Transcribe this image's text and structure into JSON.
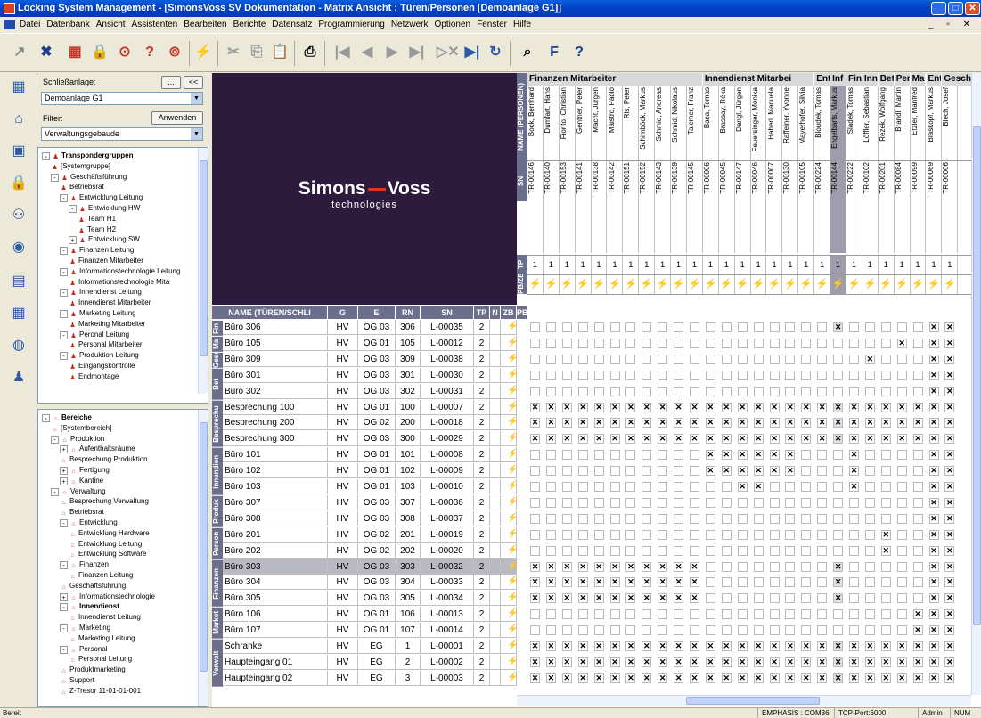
{
  "window": {
    "title": "Locking System Management - [SimonsVoss SV Dokumentation - Matrix Ansicht : Türen/Personen [Demoanlage G1]]"
  },
  "menu": [
    "Datei",
    "Datenbank",
    "Ansicht",
    "Assistenten",
    "Bearbeiten",
    "Berichte",
    "Datensatz",
    "Programmierung",
    "Netzwerk",
    "Optionen",
    "Fenster",
    "Hilfe"
  ],
  "filter": {
    "schliessanlage_label": "Schließanlage:",
    "schliessanlage_value": "Demoanlage G1",
    "browse_btn": "...",
    "collapse_btn": "<<",
    "filter_label": "Filter:",
    "apply_btn": "Anwenden",
    "filter_value": "Verwaltungsgebaude"
  },
  "tree_transponder": [
    {
      "d": 0,
      "t": "Transpondergruppen",
      "b": true,
      "exp": "-"
    },
    {
      "d": 1,
      "t": "[Systemgruppe]"
    },
    {
      "d": 1,
      "t": "Geschäftsführung",
      "exp": "-"
    },
    {
      "d": 2,
      "t": "Betriebsrat"
    },
    {
      "d": 2,
      "t": "Entwicklung Leitung",
      "exp": "-"
    },
    {
      "d": 3,
      "t": "Entwicklung HW",
      "exp": "-"
    },
    {
      "d": 4,
      "t": "Team H1"
    },
    {
      "d": 4,
      "t": "Team H2"
    },
    {
      "d": 3,
      "t": "Entwicklung SW",
      "exp": "+"
    },
    {
      "d": 2,
      "t": "Finanzen Leitung",
      "exp": "-"
    },
    {
      "d": 3,
      "t": "Finanzen Mitarbeiter"
    },
    {
      "d": 2,
      "t": "Informationstechnologie Leitung",
      "exp": "-"
    },
    {
      "d": 3,
      "t": "Informationstechnologie Mita"
    },
    {
      "d": 2,
      "t": "Innendienst Leitung",
      "exp": "-"
    },
    {
      "d": 3,
      "t": "Innendienst Mitarbeiter"
    },
    {
      "d": 2,
      "t": "Marketing Leitung",
      "exp": "-"
    },
    {
      "d": 3,
      "t": "Marketing Mitarbeiter"
    },
    {
      "d": 2,
      "t": "Peronal Leitung",
      "exp": "-"
    },
    {
      "d": 3,
      "t": "Personal Mitarbeiter"
    },
    {
      "d": 2,
      "t": "Produktion Leitung",
      "exp": "-"
    },
    {
      "d": 3,
      "t": "Eingangskontrolle"
    },
    {
      "d": 3,
      "t": "Endmontage"
    }
  ],
  "tree_bereiche": [
    {
      "d": 0,
      "t": "Bereiche",
      "b": true,
      "exp": "-"
    },
    {
      "d": 1,
      "t": "[Systembereich]"
    },
    {
      "d": 1,
      "t": "Produktion",
      "exp": "-"
    },
    {
      "d": 2,
      "t": "Aufenthaltsräume",
      "exp": "+"
    },
    {
      "d": 2,
      "t": "Besprechung Produktion"
    },
    {
      "d": 2,
      "t": "Fertigung",
      "exp": "+"
    },
    {
      "d": 2,
      "t": "Kantine",
      "exp": "+"
    },
    {
      "d": 1,
      "t": "Verwaltung",
      "exp": "-"
    },
    {
      "d": 2,
      "t": "Besprechung Verwaltung"
    },
    {
      "d": 2,
      "t": "Betriebsrat"
    },
    {
      "d": 2,
      "t": "Entwicklung",
      "exp": "-"
    },
    {
      "d": 3,
      "t": "Entwicklung Hardware"
    },
    {
      "d": 3,
      "t": "Entwicklung Leitung"
    },
    {
      "d": 3,
      "t": "Entwicklung Software"
    },
    {
      "d": 2,
      "t": "Finanzen",
      "exp": "-"
    },
    {
      "d": 3,
      "t": "Finanzen Leitung"
    },
    {
      "d": 2,
      "t": "Geschäftsführung"
    },
    {
      "d": 2,
      "t": "Informationstechnologie",
      "exp": "+"
    },
    {
      "d": 2,
      "t": "Innendienst",
      "b": true,
      "exp": "-"
    },
    {
      "d": 3,
      "t": "Innendienst Leitung"
    },
    {
      "d": 2,
      "t": "Marketing",
      "exp": "-"
    },
    {
      "d": 3,
      "t": "Marketing Leitung"
    },
    {
      "d": 2,
      "t": "Personal",
      "exp": "-"
    },
    {
      "d": 3,
      "t": "Personal Leitung"
    },
    {
      "d": 2,
      "t": "Produktmarketing"
    },
    {
      "d": 2,
      "t": "Support"
    },
    {
      "d": 2,
      "t": "Z-Tresor 11-01-01-001"
    }
  ],
  "logo": {
    "brand1": "Simons",
    "brand2": "Voss",
    "tagline": "technologies"
  },
  "matrix": {
    "side_labels": {
      "name": "NAME (PERSONEN)",
      "sn": "SN",
      "tp": "TP",
      "pbzb": "PB/ZB"
    },
    "person_groups": [
      {
        "label": "Finanzen Mitarbeiter",
        "span": 11
      },
      {
        "label": "Innendienst Mitarbei",
        "span": 7
      },
      {
        "label": "Ent",
        "span": 1
      },
      {
        "label": "Inf",
        "span": 1
      },
      {
        "label": "Fin",
        "span": 1
      },
      {
        "label": "Inn",
        "span": 1
      },
      {
        "label": "Bet",
        "span": 1
      },
      {
        "label": "Per",
        "span": 1
      },
      {
        "label": "Ma",
        "span": 1
      },
      {
        "label": "Ent",
        "span": 1
      },
      {
        "label": "Geschä",
        "span": 2
      }
    ],
    "persons": [
      {
        "name": "Bock, Bernhard",
        "sn": "TR-00146"
      },
      {
        "name": "Dumfart, Hans",
        "sn": "TR-00140"
      },
      {
        "name": "Fiorito, Christian",
        "sn": "TR-00153"
      },
      {
        "name": "Gentner, Peter",
        "sn": "TR-00141"
      },
      {
        "name": "Macht, Jürgen",
        "sn": "TR-00138"
      },
      {
        "name": "Maistro, Paolo",
        "sn": "TR-00142"
      },
      {
        "name": "Ris, Peter",
        "sn": "TR-00151"
      },
      {
        "name": "Schimböck, Markus",
        "sn": "TR-00152"
      },
      {
        "name": "Schmid, Andreas",
        "sn": "TR-00143"
      },
      {
        "name": "Schmid, Nikolaus",
        "sn": "TR-00139"
      },
      {
        "name": "Talemer, Franz",
        "sn": "TR-00145"
      },
      {
        "name": "Baca, Tomas",
        "sn": "TR-00006"
      },
      {
        "name": "Brassay, Réka",
        "sn": "TR-00045"
      },
      {
        "name": "Dangl, Jürgen",
        "sn": "TR-00147"
      },
      {
        "name": "Feuersinger, Monika",
        "sn": "TR-00046"
      },
      {
        "name": "Haberl, Manuela",
        "sn": "TR-00007"
      },
      {
        "name": "Raffeiner, Yvonne",
        "sn": "TR-00130"
      },
      {
        "name": "Mayerhofer, Silvia",
        "sn": "TR-00105"
      },
      {
        "name": "Bloudek, Tomas",
        "sn": "TR-00224"
      },
      {
        "name": "Engelbarts, Markus",
        "sn": "TR-00144",
        "sel": true
      },
      {
        "name": "Sladek, Tomas",
        "sn": "TR-00222"
      },
      {
        "name": "Löffler, Sebastian",
        "sn": "TR-00102"
      },
      {
        "name": "Rezek, Wolfgang",
        "sn": "TR-00201"
      },
      {
        "name": "Brandl, Martin",
        "sn": "TR-00084"
      },
      {
        "name": "Etzler, Manfred",
        "sn": "TR-00099"
      },
      {
        "name": "Blaskopf, Markus",
        "sn": "TR-00069"
      },
      {
        "name": "Blech, Josef",
        "sn": "TR-00006"
      }
    ],
    "tp_value": "1",
    "door_headers": [
      "NAME (TÜREN/SCHLI",
      "G",
      "E",
      "RN",
      "SN",
      "TP",
      "N",
      "ZB",
      "PB"
    ],
    "door_groups": [
      {
        "label": "Fin",
        "rows": 1
      },
      {
        "label": "Ma",
        "rows": 1
      },
      {
        "label": "Geschä",
        "rows": 1
      },
      {
        "label": "Bet",
        "rows": 2
      },
      {
        "label": "Besprechu",
        "rows": 3
      },
      {
        "label": "Innendien",
        "rows": 3
      },
      {
        "label": "Produk",
        "rows": 2
      },
      {
        "label": "Person",
        "rows": 2
      },
      {
        "label": "Finanzen",
        "rows": 3
      },
      {
        "label": "Market",
        "rows": 2
      },
      {
        "label": "Verwalt",
        "rows": 3
      }
    ],
    "doors": [
      {
        "name": "Büro 306",
        "g": "HV",
        "e": "OG 03",
        "rn": "306",
        "sn": "L-00035",
        "tp": "2",
        "x": [
          19,
          25,
          26
        ]
      },
      {
        "name": "Büro 105",
        "g": "HV",
        "e": "OG 01",
        "rn": "105",
        "sn": "L-00012",
        "tp": "2",
        "x": [
          23,
          25,
          26
        ]
      },
      {
        "name": "Büro 309",
        "g": "HV",
        "e": "OG 03",
        "rn": "309",
        "sn": "L-00038",
        "tp": "2",
        "x": [
          21,
          25,
          26
        ]
      },
      {
        "name": "Büro 301",
        "g": "HV",
        "e": "OG 03",
        "rn": "301",
        "sn": "L-00030",
        "tp": "2",
        "x": [
          25,
          26
        ]
      },
      {
        "name": "Büro 302",
        "g": "HV",
        "e": "OG 03",
        "rn": "302",
        "sn": "L-00031",
        "tp": "2",
        "x": [
          25,
          26
        ]
      },
      {
        "name": "Besprechung 100",
        "g": "HV",
        "e": "OG 01",
        "rn": "100",
        "sn": "L-00007",
        "tp": "2",
        "x": "all"
      },
      {
        "name": "Besprechung 200",
        "g": "HV",
        "e": "OG 02",
        "rn": "200",
        "sn": "L-00018",
        "tp": "2",
        "x": "all"
      },
      {
        "name": "Besprechung 300",
        "g": "HV",
        "e": "OG 03",
        "rn": "300",
        "sn": "L-00029",
        "tp": "2",
        "x": "all"
      },
      {
        "name": "Büro 101",
        "g": "HV",
        "e": "OG 01",
        "rn": "101",
        "sn": "L-00008",
        "tp": "2",
        "x": [
          11,
          12,
          13,
          14,
          15,
          16,
          20,
          25,
          26
        ]
      },
      {
        "name": "Büro 102",
        "g": "HV",
        "e": "OG 01",
        "rn": "102",
        "sn": "L-00009",
        "tp": "2",
        "x": [
          11,
          12,
          13,
          14,
          15,
          16,
          20,
          25,
          26
        ]
      },
      {
        "name": "Büro 103",
        "g": "HV",
        "e": "OG 01",
        "rn": "103",
        "sn": "L-00010",
        "tp": "2",
        "x": [
          13,
          14,
          20,
          25,
          26
        ]
      },
      {
        "name": "Büro 307",
        "g": "HV",
        "e": "OG 03",
        "rn": "307",
        "sn": "L-00036",
        "tp": "2",
        "x": [
          25,
          26
        ]
      },
      {
        "name": "Büro 308",
        "g": "HV",
        "e": "OG 03",
        "rn": "308",
        "sn": "L-00037",
        "tp": "2",
        "x": [
          25,
          26
        ]
      },
      {
        "name": "Büro 201",
        "g": "HV",
        "e": "OG 02",
        "rn": "201",
        "sn": "L-00019",
        "tp": "2",
        "x": [
          22,
          25,
          26
        ]
      },
      {
        "name": "Büro 202",
        "g": "HV",
        "e": "OG 02",
        "rn": "202",
        "sn": "L-00020",
        "tp": "2",
        "x": [
          22,
          25,
          26
        ]
      },
      {
        "name": "Büro 303",
        "g": "HV",
        "e": "OG 03",
        "rn": "303",
        "sn": "L-00032",
        "tp": "2",
        "x": [
          0,
          1,
          2,
          3,
          4,
          5,
          6,
          7,
          8,
          9,
          10,
          19,
          25,
          26
        ],
        "sel": true
      },
      {
        "name": "Büro 304",
        "g": "HV",
        "e": "OG 03",
        "rn": "304",
        "sn": "L-00033",
        "tp": "2",
        "x": [
          0,
          1,
          2,
          3,
          4,
          5,
          6,
          7,
          8,
          9,
          10,
          19,
          25,
          26
        ]
      },
      {
        "name": "Büro 305",
        "g": "HV",
        "e": "OG 03",
        "rn": "305",
        "sn": "L-00034",
        "tp": "2",
        "x": [
          0,
          1,
          2,
          3,
          4,
          5,
          6,
          7,
          8,
          9,
          10,
          19,
          25,
          26
        ]
      },
      {
        "name": "Büro 106",
        "g": "HV",
        "e": "OG 01",
        "rn": "106",
        "sn": "L-00013",
        "tp": "2",
        "x": [
          24,
          25,
          26
        ]
      },
      {
        "name": "Büro 107",
        "g": "HV",
        "e": "OG 01",
        "rn": "107",
        "sn": "L-00014",
        "tp": "2",
        "x": [
          24,
          25,
          26
        ]
      },
      {
        "name": "Schranke",
        "g": "HV",
        "e": "EG",
        "rn": "1",
        "sn": "L-00001",
        "tp": "2",
        "x": "all"
      },
      {
        "name": "Haupteingang 01",
        "g": "HV",
        "e": "EG",
        "rn": "2",
        "sn": "L-00002",
        "tp": "2",
        "x": "all"
      },
      {
        "name": "Haupteingang 02",
        "g": "HV",
        "e": "EG",
        "rn": "3",
        "sn": "L-00003",
        "tp": "2",
        "x": "all"
      }
    ]
  },
  "status": {
    "left": "Bereit",
    "conn": "EMPHASIS : COM36",
    "port": "TCP-Port:6000",
    "user": "Admin",
    "num": "NUM"
  }
}
